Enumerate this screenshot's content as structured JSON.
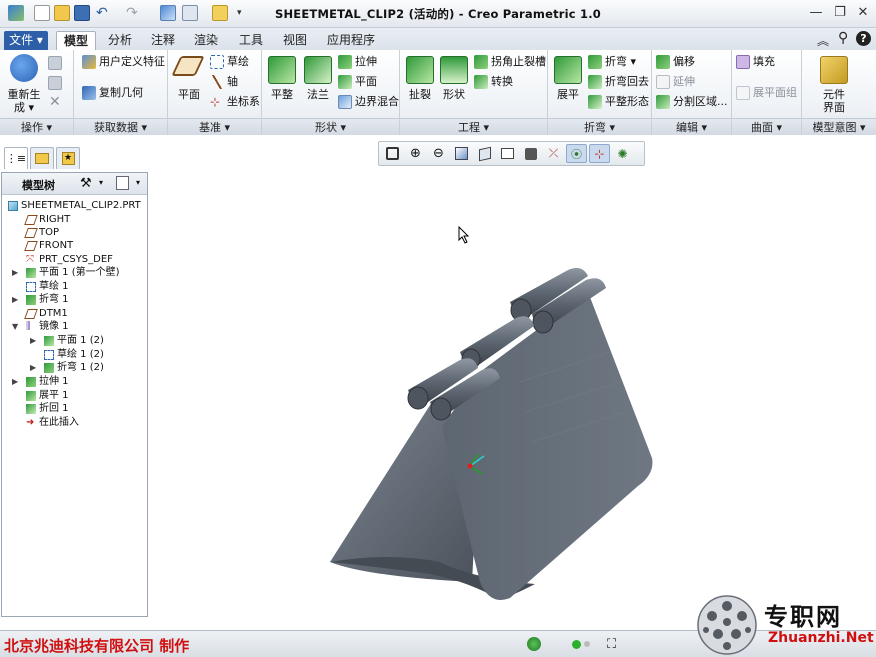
{
  "window": {
    "title": "SHEETMETAL_CLIP2 (活动的) - Creo Parametric 1.0",
    "minimize": "—",
    "restore": "❐",
    "close": "✕"
  },
  "tabs": [
    "文件 ▾",
    "模型",
    "分析",
    "注释",
    "渲染",
    "工具",
    "视图",
    "应用程序"
  ],
  "ribbon": {
    "groups": {
      "operations": "操作 ▾",
      "get_data": "获取数据 ▾",
      "datum": "基准 ▾",
      "shapes": "形状 ▾",
      "engineering": "工程 ▾",
      "bend": "折弯 ▾",
      "edit": "编辑 ▾",
      "surface": "曲面 ▾",
      "model_intent": "模型意图 ▾"
    },
    "regenerate_line1": "重新生",
    "regenerate_line2": "成 ▾",
    "udf": "用户定义特征",
    "copy_geom": "复制几何",
    "plane": "平面",
    "sketch": "草绘",
    "axis": "轴",
    "csys": "坐标系",
    "flat": "平整",
    "flange": "法兰",
    "extrude": "拉伸",
    "planar": "平面",
    "blend": "边界混合",
    "rip": "扯裂",
    "form": "形状",
    "corner_relief": "拐角止裂槽",
    "convert": "转换",
    "unbend": "展平",
    "bend": "折弯 ▾",
    "bend_back": "折弯回去",
    "flat_pattern": "平整形态",
    "offset": "偏移",
    "extend": "延伸",
    "split": "分割区域...",
    "fill": "填充",
    "flat_quilt": "展平面组",
    "component_line1": "元件",
    "component_line2": "界面"
  },
  "tree": {
    "title": "模型树",
    "items": [
      "SHEETMETAL_CLIP2.PRT",
      "RIGHT",
      "TOP",
      "FRONT",
      "PRT_CSYS_DEF",
      "平面 1 (第一个壁)",
      "草绘 1",
      "折弯 1",
      "DTM1",
      "镜像 1",
      "平面 1 (2)",
      "草绘 1 (2)",
      "折弯 1 (2)",
      "拉伸 1",
      "展平 1",
      "折回 1",
      "在此插入"
    ]
  },
  "footer": {
    "company": "北京兆迪科技有限公司  制作",
    "watermark_cn": "专职网",
    "watermark_en": "Zhuanzhi.Net"
  },
  "colors": {
    "accent": "#2d5fa8",
    "part": "#5c6570",
    "red": "#d01010"
  }
}
